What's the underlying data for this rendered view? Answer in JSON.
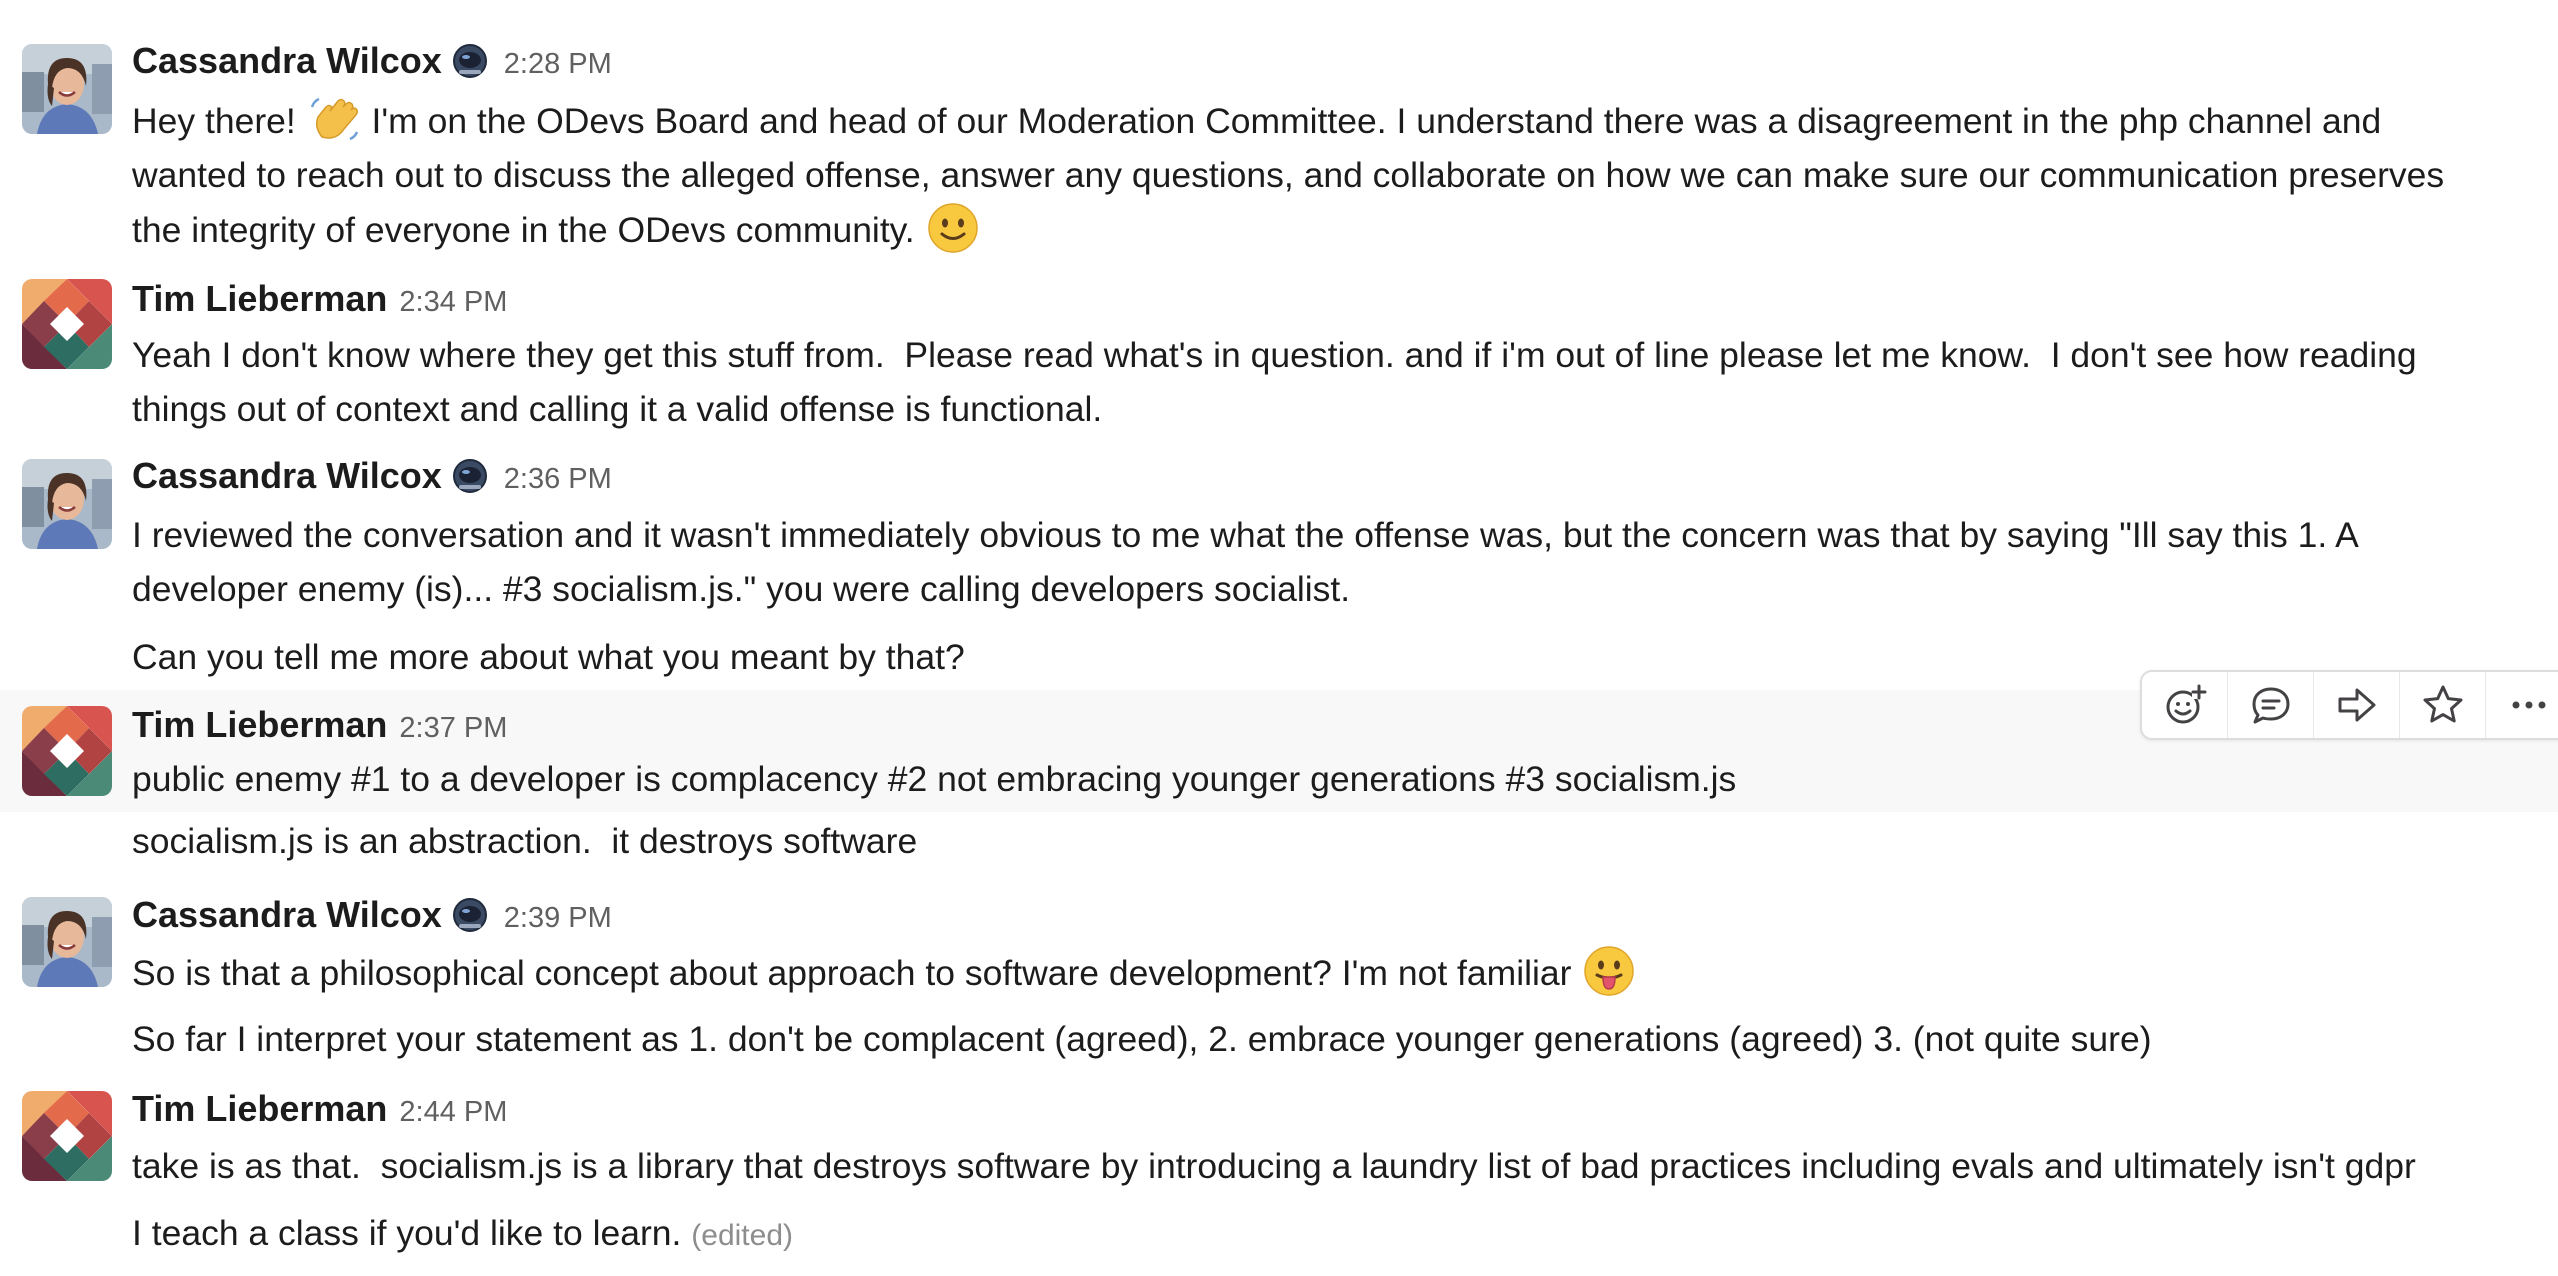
{
  "messages": [
    {
      "author": "Cassandra Wilcox",
      "time": "2:28 PM",
      "status_icon": "astronaut-helmet-icon",
      "lines": [
        {
          "before": "Hey there! ",
          "emoji": "waving-hand-icon",
          "after": " I'm on the ODevs Board and head of our Moderation Committee. I understand there was a disagreement in the php channel and"
        },
        {
          "text": "wanted to reach out to discuss the alleged offense, answer any questions, and collaborate on how we can make sure our communication preserves"
        },
        {
          "before": "the integrity of everyone in the ODevs community. ",
          "emoji": "slightly-smiling-face-icon"
        }
      ]
    },
    {
      "author": "Tim Lieberman",
      "time": "2:34 PM",
      "lines": [
        {
          "text": "Yeah I don't know where they get this stuff from.  Please read what's in question. and if i'm out of line please let me know.  I don't see how reading"
        },
        {
          "text": "things out of context and calling it a valid offense is functional."
        }
      ]
    },
    {
      "author": "Cassandra Wilcox",
      "time": "2:36 PM",
      "status_icon": "astronaut-helmet-icon",
      "lines": [
        {
          "text": "I reviewed the conversation and it wasn't immediately obvious to me what the offense was, but the concern was that by saying \"Ill say this 1. A"
        },
        {
          "text": "developer enemy (is)... #3 socialism.js.\" you were calling developers socialist."
        },
        {
          "text": "Can you tell me more about what you meant by that?"
        }
      ]
    },
    {
      "author": "Tim Lieberman",
      "time": "2:37 PM",
      "lines": [
        {
          "text": "public enemy #1 to a developer is complacency #2 not embracing younger generations #3 socialism.js"
        },
        {
          "text": "socialism.js is an abstraction.  it destroys software"
        }
      ]
    },
    {
      "author": "Cassandra Wilcox",
      "time": "2:39 PM",
      "status_icon": "astronaut-helmet-icon",
      "lines": [
        {
          "before": "So is that a philosophical concept about approach to software development? I'm not familiar ",
          "emoji": "face-with-tongue-icon"
        },
        {
          "text": "So far I interpret your statement as 1. don't be complacent (agreed), 2. embrace younger generations (agreed) 3. (not quite sure)"
        }
      ]
    },
    {
      "author": "Tim Lieberman",
      "time": "2:44 PM",
      "lines": [
        {
          "text": "take is as that.  socialism.js is a library that destroys software by introducing a laundry list of bad practices including evals and ultimately isn't gdpr"
        },
        {
          "text": "I teach a class if you'd like to learn. ",
          "edited": "(edited)"
        }
      ]
    }
  ],
  "hover_toolbar": {
    "buttons": [
      {
        "icon": "add-reaction-icon"
      },
      {
        "icon": "reply-in-thread-icon"
      },
      {
        "icon": "share-message-icon"
      },
      {
        "icon": "save-star-icon"
      },
      {
        "icon": "more-actions-icon"
      }
    ]
  },
  "colors": {
    "text": "#1d1c1d",
    "timestamp": "#616061",
    "edited": "#8d8d8d",
    "hover_background": "#f8f8f8",
    "toolbar_border": "#dddddd"
  }
}
